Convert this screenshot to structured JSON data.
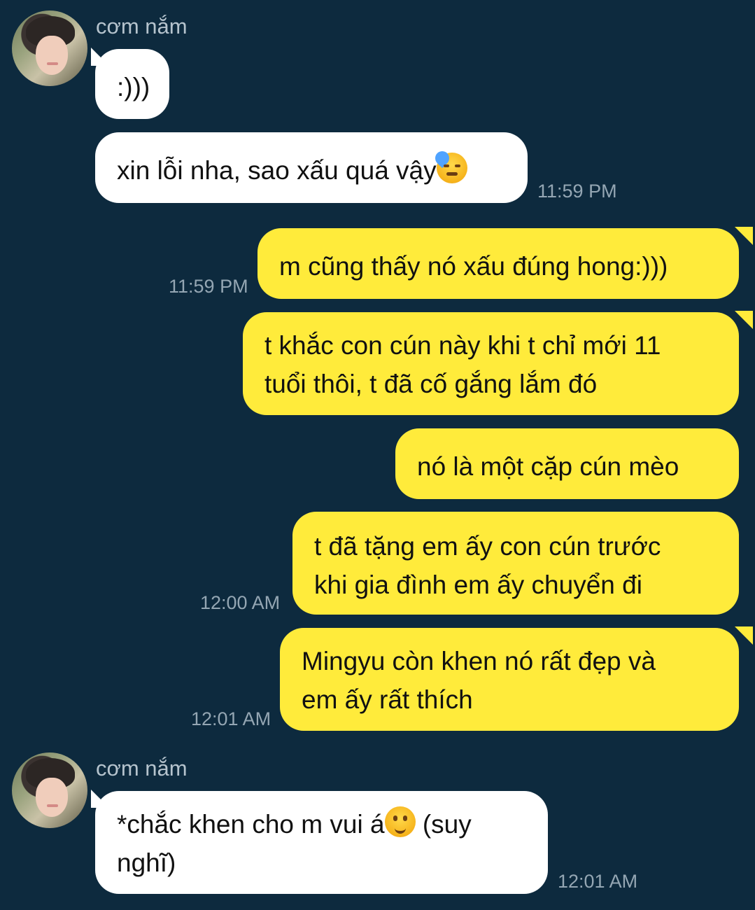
{
  "contact": {
    "name": "cơm nắm"
  },
  "messages": [
    {
      "text": ":)))"
    },
    {
      "text": "xin lỗi nha, sao xấu quá vậy",
      "emoji": "downcast-sweat-emoji",
      "time": "11:59 PM"
    },
    {
      "text": "m cũng thấy nó xấu đúng hong:)))",
      "time": "11:59 PM"
    },
    {
      "line1": "t khắc con cún này khi t chỉ mới 11",
      "line2": "tuổi thôi, t đã cố gắng lắm đó"
    },
    {
      "text": "nó là một cặp cún mèo"
    },
    {
      "line1": "t đã tặng em ấy con cún trước",
      "line2": "khi gia đình em ấy chuyển đi",
      "time": "12:00 AM"
    },
    {
      "line1": "Mingyu còn khen nó rất đẹp và",
      "line2": "em ấy rất thích",
      "time": "12:01 AM"
    },
    {
      "line1": "*chắc khen cho m vui á",
      "line1_after": " (suy",
      "line2": "nghĩ)",
      "emoji": "slight-smile-emoji",
      "time": "12:01 AM"
    }
  ],
  "colors": {
    "background": "#0d2a3e",
    "incoming_bubble": "#ffffff",
    "outgoing_bubble": "#ffeb3b",
    "timestamp": "#94a6b3",
    "sender_name": "#b5c3cd"
  }
}
